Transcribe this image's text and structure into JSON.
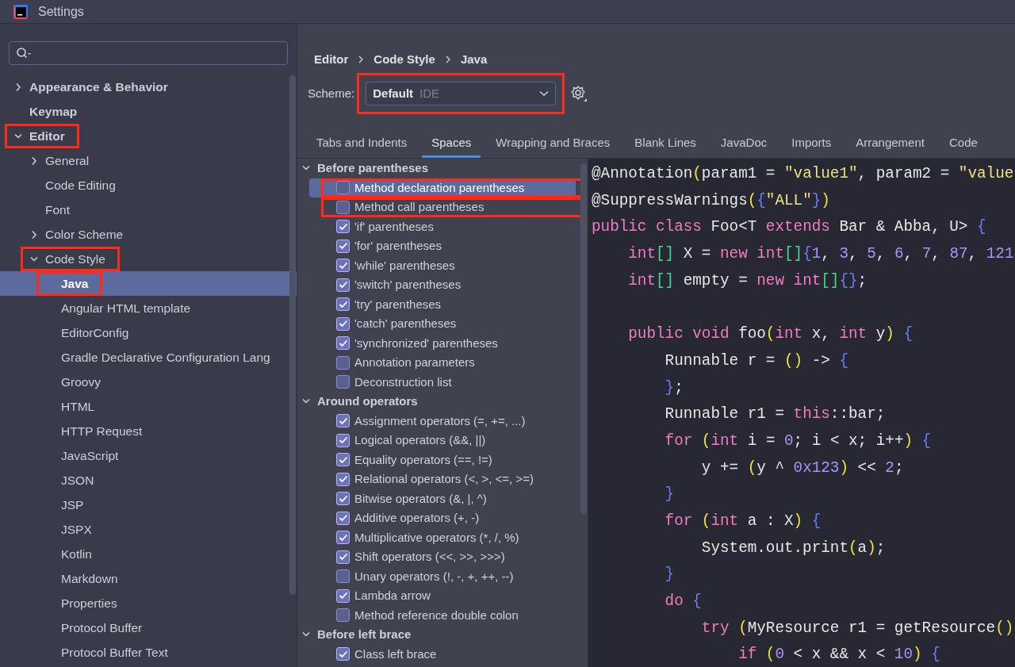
{
  "window": {
    "title": "Settings"
  },
  "sidebar": {
    "items": [
      {
        "label": "Appearance & Behavior",
        "kind": "group",
        "expanded": false,
        "selected": false
      },
      {
        "label": "Keymap",
        "kind": "leaf",
        "selected": false
      },
      {
        "label": "Editor",
        "kind": "group",
        "expanded": true,
        "selected": false,
        "marked": true,
        "children": [
          {
            "label": "General",
            "kind": "group",
            "expanded": false,
            "selected": false
          },
          {
            "label": "Code Editing",
            "kind": "leaf",
            "selected": false
          },
          {
            "label": "Font",
            "kind": "leaf",
            "selected": false
          },
          {
            "label": "Color Scheme",
            "kind": "group",
            "expanded": false,
            "selected": false
          },
          {
            "label": "Code Style",
            "kind": "group",
            "expanded": true,
            "selected": false,
            "marked": true,
            "children": [
              {
                "label": "Java",
                "kind": "leaf",
                "selected": true,
                "marked": true
              },
              {
                "label": "Angular HTML template",
                "kind": "leaf",
                "selected": false
              },
              {
                "label": "EditorConfig",
                "kind": "leaf",
                "selected": false
              },
              {
                "label": "Gradle Declarative Configuration Lang",
                "kind": "leaf",
                "selected": false
              },
              {
                "label": "Groovy",
                "kind": "leaf",
                "selected": false
              },
              {
                "label": "HTML",
                "kind": "leaf",
                "selected": false
              },
              {
                "label": "HTTP Request",
                "kind": "leaf",
                "selected": false
              },
              {
                "label": "JavaScript",
                "kind": "leaf",
                "selected": false
              },
              {
                "label": "JSON",
                "kind": "leaf",
                "selected": false
              },
              {
                "label": "JSP",
                "kind": "leaf",
                "selected": false
              },
              {
                "label": "JSPX",
                "kind": "leaf",
                "selected": false
              },
              {
                "label": "Kotlin",
                "kind": "leaf",
                "selected": false
              },
              {
                "label": "Markdown",
                "kind": "leaf",
                "selected": false
              },
              {
                "label": "Properties",
                "kind": "leaf",
                "selected": false
              },
              {
                "label": "Protocol Buffer",
                "kind": "leaf",
                "selected": false
              },
              {
                "label": "Protocol Buffer Text",
                "kind": "leaf",
                "selected": false
              }
            ]
          }
        ]
      }
    ]
  },
  "breadcrumb": [
    "Editor",
    "Code Style",
    "Java"
  ],
  "scheme": {
    "label": "Scheme:",
    "value": "Default",
    "qualifier": "IDE",
    "marked": true
  },
  "tabs": [
    {
      "label": "Tabs and Indents",
      "selected": false
    },
    {
      "label": "Spaces",
      "selected": true
    },
    {
      "label": "Wrapping and Braces",
      "selected": false
    },
    {
      "label": "Blank Lines",
      "selected": false
    },
    {
      "label": "JavaDoc",
      "selected": false
    },
    {
      "label": "Imports",
      "selected": false
    },
    {
      "label": "Arrangement",
      "selected": false
    },
    {
      "label": "Code",
      "selected": false
    }
  ],
  "options": [
    {
      "kind": "group",
      "label": "Before parentheses",
      "expanded": true,
      "children": [
        {
          "kind": "check",
          "label": "Method declaration parentheses",
          "checked": false,
          "selected": true,
          "marked": true
        },
        {
          "kind": "check",
          "label": "Method call parentheses",
          "checked": false,
          "selected": false,
          "marked": true
        },
        {
          "kind": "check",
          "label": "'if' parentheses",
          "checked": true,
          "selected": false
        },
        {
          "kind": "check",
          "label": "'for' parentheses",
          "checked": true,
          "selected": false
        },
        {
          "kind": "check",
          "label": "'while' parentheses",
          "checked": true,
          "selected": false
        },
        {
          "kind": "check",
          "label": "'switch' parentheses",
          "checked": true,
          "selected": false
        },
        {
          "kind": "check",
          "label": "'try' parentheses",
          "checked": true,
          "selected": false
        },
        {
          "kind": "check",
          "label": "'catch' parentheses",
          "checked": true,
          "selected": false
        },
        {
          "kind": "check",
          "label": "'synchronized' parentheses",
          "checked": true,
          "selected": false
        },
        {
          "kind": "check",
          "label": "Annotation parameters",
          "checked": false,
          "selected": false
        },
        {
          "kind": "check",
          "label": "Deconstruction list",
          "checked": false,
          "selected": false
        }
      ]
    },
    {
      "kind": "group",
      "label": "Around operators",
      "expanded": true,
      "children": [
        {
          "kind": "check",
          "label": "Assignment operators (=, +=, ...)",
          "checked": true,
          "selected": false
        },
        {
          "kind": "check",
          "label": "Logical operators (&&, ||)",
          "checked": true,
          "selected": false
        },
        {
          "kind": "check",
          "label": "Equality operators (==, !=)",
          "checked": true,
          "selected": false
        },
        {
          "kind": "check",
          "label": "Relational operators (<, >, <=, >=)",
          "checked": true,
          "selected": false
        },
        {
          "kind": "check",
          "label": "Bitwise operators (&, |, ^)",
          "checked": true,
          "selected": false
        },
        {
          "kind": "check",
          "label": "Additive operators (+, -)",
          "checked": true,
          "selected": false
        },
        {
          "kind": "check",
          "label": "Multiplicative operators (*, /, %)",
          "checked": true,
          "selected": false
        },
        {
          "kind": "check",
          "label": "Shift operators (<<, >>, >>>)",
          "checked": true,
          "selected": false
        },
        {
          "kind": "check",
          "label": "Unary operators (!, -, +, ++, --)",
          "checked": false,
          "selected": false
        },
        {
          "kind": "check",
          "label": "Lambda arrow",
          "checked": true,
          "selected": false
        },
        {
          "kind": "check",
          "label": "Method reference double colon",
          "checked": false,
          "selected": false
        }
      ]
    },
    {
      "kind": "group",
      "label": "Before left brace",
      "expanded": true,
      "children": [
        {
          "kind": "check",
          "label": "Class left brace",
          "checked": true,
          "selected": false
        }
      ]
    }
  ],
  "code_preview": [
    {
      "kind": "code",
      "tokens": [
        {
          "kind": "plain",
          "text": "@Annotation"
        },
        {
          "kind": "paren",
          "text": "("
        },
        {
          "kind": "plain",
          "text": "param1 = "
        },
        {
          "kind": "string",
          "text": "\"value1\""
        },
        {
          "kind": "plain",
          "text": ", param2 = "
        },
        {
          "kind": "string",
          "text": "\"value"
        }
      ]
    },
    {
      "kind": "code",
      "tokens": [
        {
          "kind": "plain",
          "text": "@SuppressWarnings"
        },
        {
          "kind": "paren",
          "text": "("
        },
        {
          "kind": "brace",
          "text": "{"
        },
        {
          "kind": "string",
          "text": "\"ALL\""
        },
        {
          "kind": "brace",
          "text": "}"
        },
        {
          "kind": "paren",
          "text": ")"
        }
      ]
    },
    {
      "kind": "code",
      "tokens": [
        {
          "kind": "keyword",
          "text": "public class "
        },
        {
          "kind": "plain",
          "text": "Foo<T "
        },
        {
          "kind": "keyword",
          "text": "extends "
        },
        {
          "kind": "plain",
          "text": "Bar & Abba, U> "
        },
        {
          "kind": "brace",
          "text": "{"
        }
      ]
    },
    {
      "kind": "code",
      "tokens": [
        {
          "kind": "keyword",
          "text": "    int"
        },
        {
          "kind": "bracket",
          "text": "[]"
        },
        {
          "kind": "plain",
          "text": " X = "
        },
        {
          "kind": "keyword",
          "text": "new int"
        },
        {
          "kind": "bracket",
          "text": "[]"
        },
        {
          "kind": "brace",
          "text": "{"
        },
        {
          "kind": "number",
          "text": "1"
        },
        {
          "kind": "plain",
          "text": ", "
        },
        {
          "kind": "number",
          "text": "3"
        },
        {
          "kind": "plain",
          "text": ", "
        },
        {
          "kind": "number",
          "text": "5"
        },
        {
          "kind": "plain",
          "text": ", "
        },
        {
          "kind": "number",
          "text": "6"
        },
        {
          "kind": "plain",
          "text": ", "
        },
        {
          "kind": "number",
          "text": "7"
        },
        {
          "kind": "plain",
          "text": ", "
        },
        {
          "kind": "number",
          "text": "87"
        },
        {
          "kind": "plain",
          "text": ", "
        },
        {
          "kind": "number",
          "text": "121"
        }
      ]
    },
    {
      "kind": "code",
      "tokens": [
        {
          "kind": "keyword",
          "text": "    int"
        },
        {
          "kind": "bracket",
          "text": "[]"
        },
        {
          "kind": "plain",
          "text": " empty = "
        },
        {
          "kind": "keyword",
          "text": "new int"
        },
        {
          "kind": "bracket",
          "text": "[]"
        },
        {
          "kind": "brace",
          "text": "{}"
        },
        {
          "kind": "plain",
          "text": ";"
        }
      ]
    },
    {
      "kind": "blank"
    },
    {
      "kind": "code",
      "tokens": [
        {
          "kind": "keyword",
          "text": "    public void "
        },
        {
          "kind": "plain",
          "text": "foo"
        },
        {
          "kind": "paren",
          "text": "("
        },
        {
          "kind": "keyword",
          "text": "int "
        },
        {
          "kind": "plain",
          "text": "x, "
        },
        {
          "kind": "keyword",
          "text": "int "
        },
        {
          "kind": "plain",
          "text": "y"
        },
        {
          "kind": "paren",
          "text": ")"
        },
        {
          "kind": "brace",
          "text": " {"
        }
      ]
    },
    {
      "kind": "code",
      "tokens": [
        {
          "kind": "plain",
          "text": "        Runnable r = "
        },
        {
          "kind": "paren",
          "text": "()"
        },
        {
          "kind": "plain",
          "text": " -> "
        },
        {
          "kind": "brace",
          "text": "{"
        }
      ]
    },
    {
      "kind": "code",
      "tokens": [
        {
          "kind": "brace",
          "text": "        }"
        },
        {
          "kind": "plain",
          "text": ";"
        }
      ]
    },
    {
      "kind": "code",
      "tokens": [
        {
          "kind": "plain",
          "text": "        Runnable r1 = "
        },
        {
          "kind": "keyword",
          "text": "this"
        },
        {
          "kind": "plain",
          "text": "::bar;"
        }
      ]
    },
    {
      "kind": "code",
      "tokens": [
        {
          "kind": "keyword",
          "text": "        for "
        },
        {
          "kind": "paren",
          "text": "("
        },
        {
          "kind": "keyword",
          "text": "int "
        },
        {
          "kind": "plain",
          "text": "i = "
        },
        {
          "kind": "number",
          "text": "0"
        },
        {
          "kind": "plain",
          "text": "; i < x; i++"
        },
        {
          "kind": "paren",
          "text": ")"
        },
        {
          "kind": "brace",
          "text": " {"
        }
      ]
    },
    {
      "kind": "code",
      "tokens": [
        {
          "kind": "plain",
          "text": "            y += "
        },
        {
          "kind": "paren",
          "text": "("
        },
        {
          "kind": "plain",
          "text": "y ^ "
        },
        {
          "kind": "number",
          "text": "0x123"
        },
        {
          "kind": "paren",
          "text": ")"
        },
        {
          "kind": "plain",
          "text": " << "
        },
        {
          "kind": "number",
          "text": "2"
        },
        {
          "kind": "plain",
          "text": ";"
        }
      ]
    },
    {
      "kind": "code",
      "tokens": [
        {
          "kind": "brace",
          "text": "        }"
        }
      ]
    },
    {
      "kind": "code",
      "tokens": [
        {
          "kind": "keyword",
          "text": "        for "
        },
        {
          "kind": "paren",
          "text": "("
        },
        {
          "kind": "keyword",
          "text": "int "
        },
        {
          "kind": "plain",
          "text": "a : X"
        },
        {
          "kind": "paren",
          "text": ")"
        },
        {
          "kind": "brace",
          "text": " {"
        }
      ]
    },
    {
      "kind": "code",
      "tokens": [
        {
          "kind": "plain",
          "text": "            System.out.print"
        },
        {
          "kind": "paren",
          "text": "("
        },
        {
          "kind": "plain",
          "text": "a"
        },
        {
          "kind": "paren",
          "text": ")"
        },
        {
          "kind": "plain",
          "text": ";"
        }
      ]
    },
    {
      "kind": "code",
      "tokens": [
        {
          "kind": "brace",
          "text": "        }"
        }
      ]
    },
    {
      "kind": "code",
      "tokens": [
        {
          "kind": "keyword",
          "text": "        do "
        },
        {
          "kind": "brace",
          "text": "{"
        }
      ]
    },
    {
      "kind": "code",
      "tokens": [
        {
          "kind": "keyword",
          "text": "            try "
        },
        {
          "kind": "paren",
          "text": "("
        },
        {
          "kind": "plain",
          "text": "MyResource r1 = getResource"
        },
        {
          "kind": "paren",
          "text": "()"
        }
      ]
    },
    {
      "kind": "code",
      "tokens": [
        {
          "kind": "keyword",
          "text": "                if "
        },
        {
          "kind": "paren",
          "text": "("
        },
        {
          "kind": "number",
          "text": "0"
        },
        {
          "kind": "plain",
          "text": " < x && x < "
        },
        {
          "kind": "number",
          "text": "10"
        },
        {
          "kind": "paren",
          "text": ")"
        },
        {
          "kind": "brace",
          "text": " {"
        }
      ]
    }
  ]
}
